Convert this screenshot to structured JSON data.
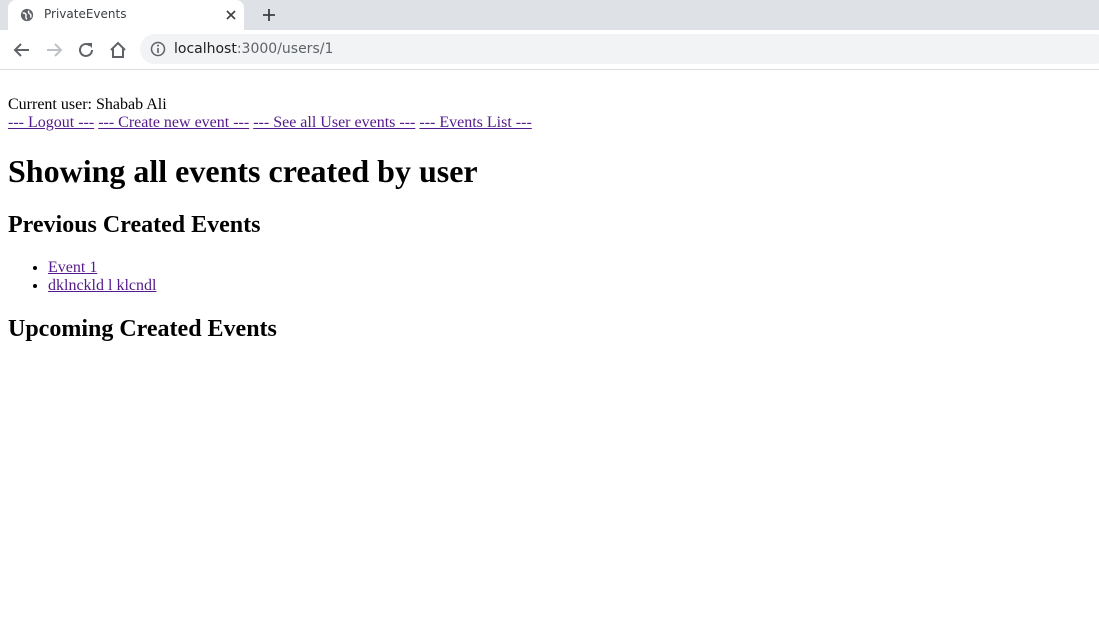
{
  "browser": {
    "tab_title": "PrivateEvents",
    "url_host": "localhost",
    "url_path": ":3000/users/1"
  },
  "page": {
    "current_user_label": "Current user: Shabab Ali",
    "nav": {
      "logout": "--- Logout ---",
      "create_event": "--- Create new event ---",
      "user_events": "--- See all User events ---",
      "events_list": "--- Events List ---"
    },
    "heading": "Showing all events created by user",
    "previous_heading": "Previous Created Events",
    "previous_events": [
      {
        "title": "Event 1"
      },
      {
        "title": "dklnckld l klcndl"
      }
    ],
    "upcoming_heading": "Upcoming Created Events"
  }
}
